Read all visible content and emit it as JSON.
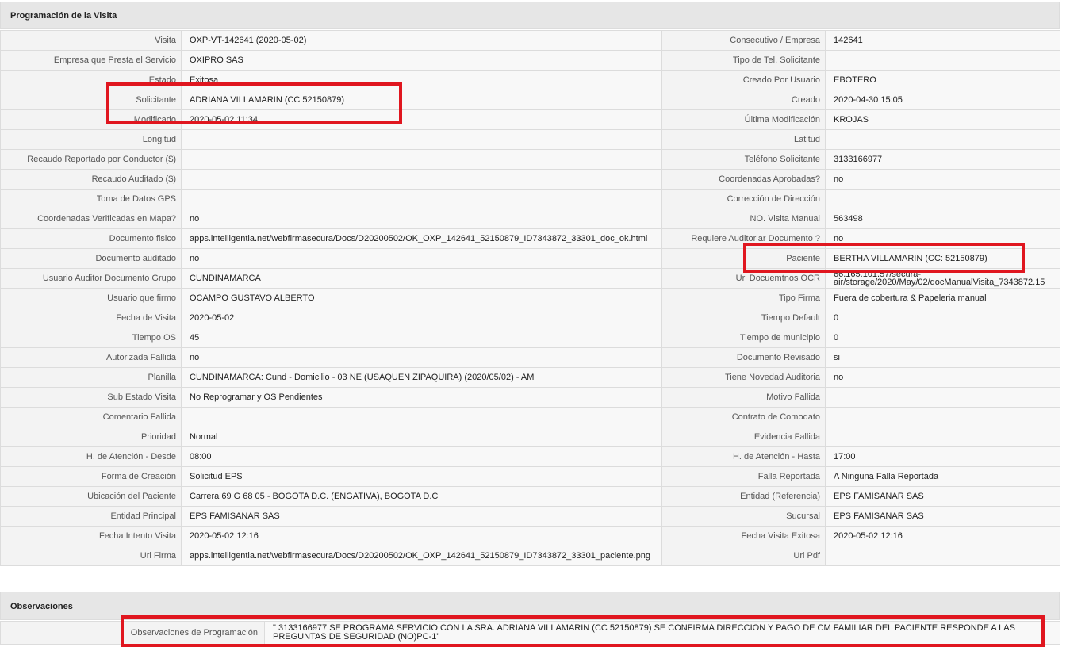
{
  "section_title": "Programación de la Visita",
  "rows": [
    {
      "l1": "Visita",
      "v1": "OXP-VT-142641 (2020-05-02)",
      "l2": "Consecutivo / Empresa",
      "v2": "142641"
    },
    {
      "l1": "Empresa que Presta el Servicio",
      "v1": "OXIPRO SAS",
      "l2": "Tipo de Tel. Solicitante",
      "v2": ""
    },
    {
      "l1": "Estado",
      "v1": "Exitosa",
      "l2": "Creado Por Usuario",
      "v2": "EBOTERO"
    },
    {
      "l1": "Solicitante",
      "v1": "ADRIANA VILLAMARIN (CC 52150879)",
      "l2": "Creado",
      "v2": "2020-04-30 15:05"
    },
    {
      "l1": "Modificado",
      "v1": "2020-05-02 11:34",
      "l2": "Última Modificación",
      "v2": "KROJAS"
    },
    {
      "l1": "Longitud",
      "v1": "",
      "l2": "Latitud",
      "v2": ""
    },
    {
      "l1": "Recaudo Reportado por Conductor ($)",
      "v1": "",
      "l2": "Teléfono Solicitante",
      "v2": "3133166977"
    },
    {
      "l1": "Recaudo Auditado ($)",
      "v1": "",
      "l2": "Coordenadas Aprobadas?",
      "v2": "no"
    },
    {
      "l1": "Toma de Datos GPS",
      "v1": "",
      "l2": "Corrección de Dirección",
      "v2": ""
    },
    {
      "l1": "Coordenadas Verificadas en Mapa?",
      "v1": "no",
      "l2": "NO. Visita Manual",
      "v2": "563498"
    },
    {
      "l1": "Documento fisico",
      "v1": "apps.intelligentia.net/webfirmasecura/Docs/D20200502/OK_OXP_142641_52150879_ID7343872_33301_doc_ok.html",
      "l2": "Requiere Auditoriar Documento ?",
      "v2": "no"
    },
    {
      "l1": "Documento auditado",
      "v1": "no",
      "l2": "Paciente",
      "v2": "BERTHA VILLAMARIN (CC: 52150879)"
    },
    {
      "l1": "Usuario Auditor Documento Grupo",
      "v1": "CUNDINAMARCA",
      "l2": "Url Docuemtnos OCR",
      "v2": "66.165.101.57/secura-air/storage/2020/May/02/docManualVisita_7343872.15"
    },
    {
      "l1": "Usuario que firmo",
      "v1": "OCAMPO GUSTAVO ALBERTO",
      "l2": "Tipo Firma",
      "v2": "Fuera de cobertura & Papeleria manual"
    },
    {
      "l1": "Fecha de Visita",
      "v1": "2020-05-02",
      "l2": "Tiempo Default",
      "v2": "0"
    },
    {
      "l1": "Tiempo OS",
      "v1": "45",
      "l2": "Tiempo de municipio",
      "v2": "0"
    },
    {
      "l1": "Autorizada Fallida",
      "v1": "no",
      "l2": "Documento Revisado",
      "v2": "si"
    },
    {
      "l1": "Planilla",
      "v1": "CUNDINAMARCA: Cund - Domicilio - 03 NE (USAQUEN ZIPAQUIRA) (2020/05/02) - AM",
      "l2": "Tiene Novedad Auditoria",
      "v2": "no"
    },
    {
      "l1": "Sub Estado Visita",
      "v1": "No Reprogramar y OS Pendientes",
      "l2": "Motivo Fallida",
      "v2": ""
    },
    {
      "l1": "Comentario Fallida",
      "v1": "",
      "l2": "Contrato de Comodato",
      "v2": ""
    },
    {
      "l1": "Prioridad",
      "v1": "Normal",
      "l2": "Evidencia Fallida",
      "v2": ""
    },
    {
      "l1": "H. de Atención - Desde",
      "v1": "08:00",
      "l2": "H. de Atención - Hasta",
      "v2": "17:00"
    },
    {
      "l1": "Forma de Creación",
      "v1": "Solicitud EPS",
      "l2": "Falla Reportada",
      "v2": "A Ninguna Falla Reportada"
    },
    {
      "l1": "Ubicación del Paciente",
      "v1": "Carrera 69 G 68 05 - BOGOTA D.C. (ENGATIVA), BOGOTA D.C",
      "l2": "Entidad (Referencia)",
      "v2": "EPS FAMISANAR SAS"
    },
    {
      "l1": "Entidad Principal",
      "v1": "EPS FAMISANAR SAS",
      "l2": "Sucursal",
      "v2": "EPS FAMISANAR SAS"
    },
    {
      "l1": "Fecha Intento Visita",
      "v1": "2020-05-02 12:16",
      "l2": "Fecha Visita Exitosa",
      "v2": "2020-05-02 12:16"
    },
    {
      "l1": "Url Firma",
      "v1": "apps.intelligentia.net/webfirmasecura/Docs/D20200502/OK_OXP_142641_52150879_ID7343872_33301_paciente.png",
      "l2": "Url Pdf",
      "v2": ""
    }
  ],
  "observaciones": {
    "title": "Observaciones",
    "label": "Observaciones de Programación",
    "value": "\" 3133166977 SE PROGRAMA SERVICIO CON LA SRA. ADRIANA VILLAMARIN (CC 52150879) SE CONFIRMA DIRECCION Y PAGO DE CM FAMILIAR DEL PACIENTE RESPONDE A LAS PREGUNTAS DE SEGURIDAD (NO)PC-1\""
  },
  "highlight_color": "#e0161f"
}
